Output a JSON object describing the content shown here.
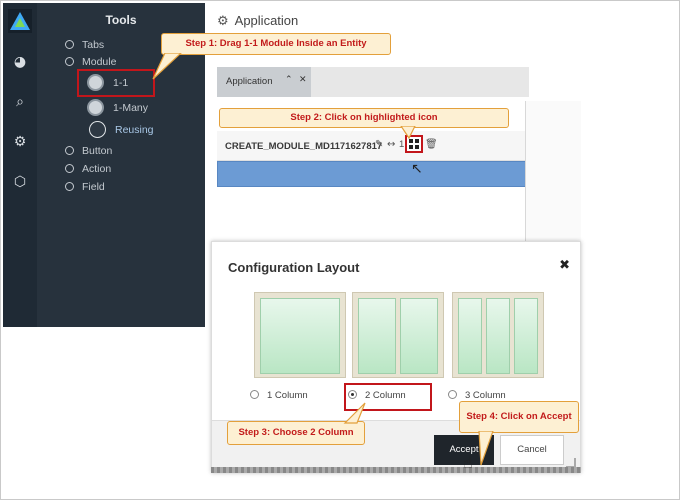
{
  "sidebar": {
    "icons": [
      {
        "name": "dashboard-icon",
        "glyph": "◕"
      },
      {
        "name": "search-icon",
        "glyph": "⌕"
      },
      {
        "name": "settings-icon",
        "glyph": "⚙"
      },
      {
        "name": "layers-icon",
        "glyph": "⬡"
      }
    ],
    "tools_title": "Tools",
    "items": {
      "tabs": "Tabs",
      "module": "Module",
      "one_to_one": "1-1",
      "one_to_many": "1-Many",
      "reusing": "Reusing",
      "button": "Button",
      "action": "Action",
      "field": "Field"
    }
  },
  "app": {
    "title": "Application",
    "tab_label": "Application",
    "tab_collapse": "⌃",
    "tab_close": "✕",
    "module_name": "CREATE_MODULE_MD1171627817",
    "module_suffix": "1"
  },
  "dialog": {
    "title": "Configuration Layout",
    "close": "✖",
    "options": [
      "1 Column",
      "2 Column",
      "3 Column"
    ],
    "selected": "2 Column",
    "accept_label": "Accept",
    "cancel_label": "Cancel"
  },
  "callouts": {
    "step1": "Step 1: Drag 1-1 Module Inside an Entity",
    "step2": "Step 2: Click on highlighted icon",
    "step3": "Step 3: Choose 2 Column",
    "step4": "Step 4: Click on Accept"
  },
  "colors": {
    "highlight_red": "#c2161b",
    "callout_bg": "#fdf0d3",
    "callout_border": "#e3a03b",
    "selection_blue": "#6c9bd4",
    "dark_panel": "#27323d"
  }
}
